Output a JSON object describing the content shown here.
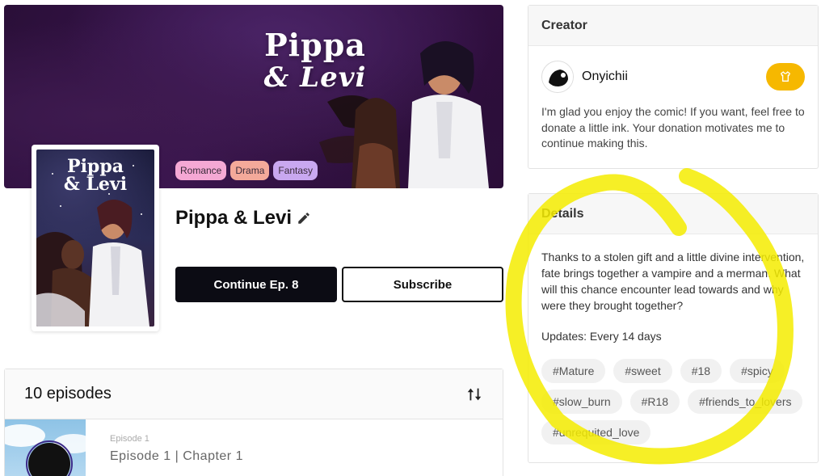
{
  "banner": {
    "title_line1": "Pippa",
    "title_line2": "& Levi"
  },
  "cover": {
    "title_line1": "Pippa",
    "title_line2": "& Levi"
  },
  "genres": [
    {
      "label": "Romance",
      "color": "#f5a8d4"
    },
    {
      "label": "Drama",
      "color": "#f4a99a"
    },
    {
      "label": "Fantasy",
      "color": "#c9a8f0"
    }
  ],
  "series": {
    "title": "Pippa & Levi",
    "edit_icon": "pencil-icon"
  },
  "actions": {
    "continue_label": "Continue Ep. 8",
    "subscribe_label": "Subscribe"
  },
  "episodes": {
    "count_label": "10 episodes",
    "sort_icon": "sort-arrows-icon",
    "items": [
      {
        "label": "Episode 1",
        "title": "Episode 1 | Chapter 1"
      }
    ]
  },
  "creator": {
    "heading": "Creator",
    "name": "Onyichii",
    "tip_icon": "shirt-icon",
    "message": "I'm glad you enjoy the comic! If you want, feel free to donate a little ink. Your donation motivates me to continue making this."
  },
  "details": {
    "heading": "Details",
    "description": "Thanks to a stolen gift and a little divine intervention, fate brings together a vampire and a merman. What will this chance encounter lead towards and why were they brought together?",
    "updates": "Updates: Every 14 days",
    "tags": [
      "#Mature",
      "#sweet",
      "#18",
      "#spicy",
      "#slow_burn",
      "#R18",
      "#friends_to_lovers",
      "#unrequited_love"
    ]
  },
  "colors": {
    "primary_button": "#0c0c14",
    "tip_button": "#f6b800",
    "highlight": "#f5ec00"
  }
}
